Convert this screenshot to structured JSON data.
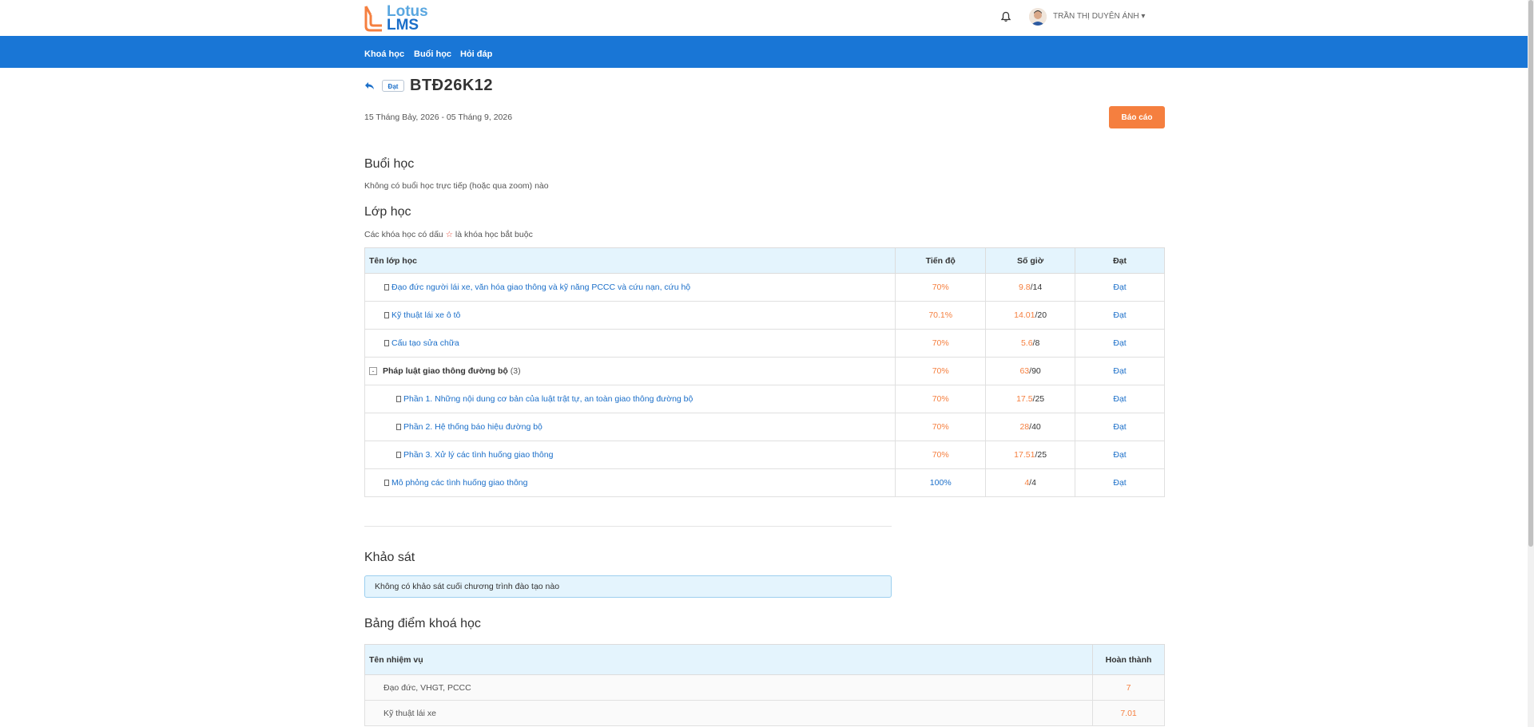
{
  "header": {
    "logo_line1": "Lotus",
    "logo_line2": "LMS",
    "user_name": "TRẦN THỊ DUYÊN ÁNH",
    "caret": "▾"
  },
  "nav": [
    "Khoá học",
    "Buổi học",
    "Hỏi đáp"
  ],
  "course": {
    "status_badge": "Đạt",
    "title": "BTĐ26K12",
    "date_range": "15 Tháng Bảy, 2026 - 05 Tháng 9, 2026",
    "report_button": "Báo cáo"
  },
  "sessions": {
    "title": "Buổi học",
    "empty_text": "Không có buổi học trực tiếp (hoặc qua zoom) nào"
  },
  "classes": {
    "title": "Lớp học",
    "note_before": "Các khóa học có dấu",
    "star": "☆",
    "note_after": "là khóa học bắt buộc",
    "headers": [
      "Tên lớp học",
      "Tiến độ",
      "Số giờ",
      "Đạt"
    ],
    "rows": [
      {
        "name": "Đạo đức người lái xe, văn hóa giao thông và kỹ năng PCCC và cứu nạn, cứu hộ",
        "progress": "70%",
        "hours_done": "9.8",
        "hours_total": "/14",
        "status": "Đạt"
      },
      {
        "name": "Kỹ thuật lái xe ô tô",
        "progress": "70.1%",
        "hours_done": "14.01",
        "hours_total": "/20",
        "status": "Đạt"
      },
      {
        "name": "Cấu tạo sửa chữa",
        "progress": "70%",
        "hours_done": "5.6",
        "hours_total": "/8",
        "status": "Đạt"
      },
      {
        "name": "Pháp luật giao thông đường bộ",
        "count": "(3)",
        "toggle": "-",
        "progress": "70%",
        "hours_done": "63",
        "hours_total": "/90",
        "status": "Đạt"
      },
      {
        "name": "Phần 1. Những nội dung cơ bản của luật trật tự, an toàn giao thông đường bộ",
        "progress": "70%",
        "hours_done": "17.5",
        "hours_total": "/25",
        "status": "Đạt"
      },
      {
        "name": "Phần 2. Hệ thống báo hiệu đường bộ",
        "progress": "70%",
        "hours_done": "28",
        "hours_total": "/40",
        "status": "Đạt"
      },
      {
        "name": "Phần 3. Xử lý các tình huống giao thông",
        "progress": "70%",
        "hours_done": "17.51",
        "hours_total": "/25",
        "status": "Đạt"
      },
      {
        "name": "Mô phỏng các tình huống giao thông",
        "progress": "100%",
        "hours_done": "4",
        "hours_total": "/4",
        "status": "Đạt"
      }
    ]
  },
  "survey": {
    "title": "Khảo sát",
    "empty_text": "Không có khảo sát cuối chương trình đào tạo nào"
  },
  "scores": {
    "title": "Bảng điểm khoá học",
    "headers": [
      "Tên nhiệm vụ",
      "Hoàn thành"
    ],
    "rows": [
      {
        "name": "Đạo đức, VHGT, PCCC",
        "value": "7"
      },
      {
        "name": "Kỹ thuật lái xe",
        "value": "7.01"
      }
    ]
  },
  "colors": {
    "primary": "#1976d6",
    "accent_orange": "#f57f3f",
    "header_bg": "#e4f4fd"
  }
}
